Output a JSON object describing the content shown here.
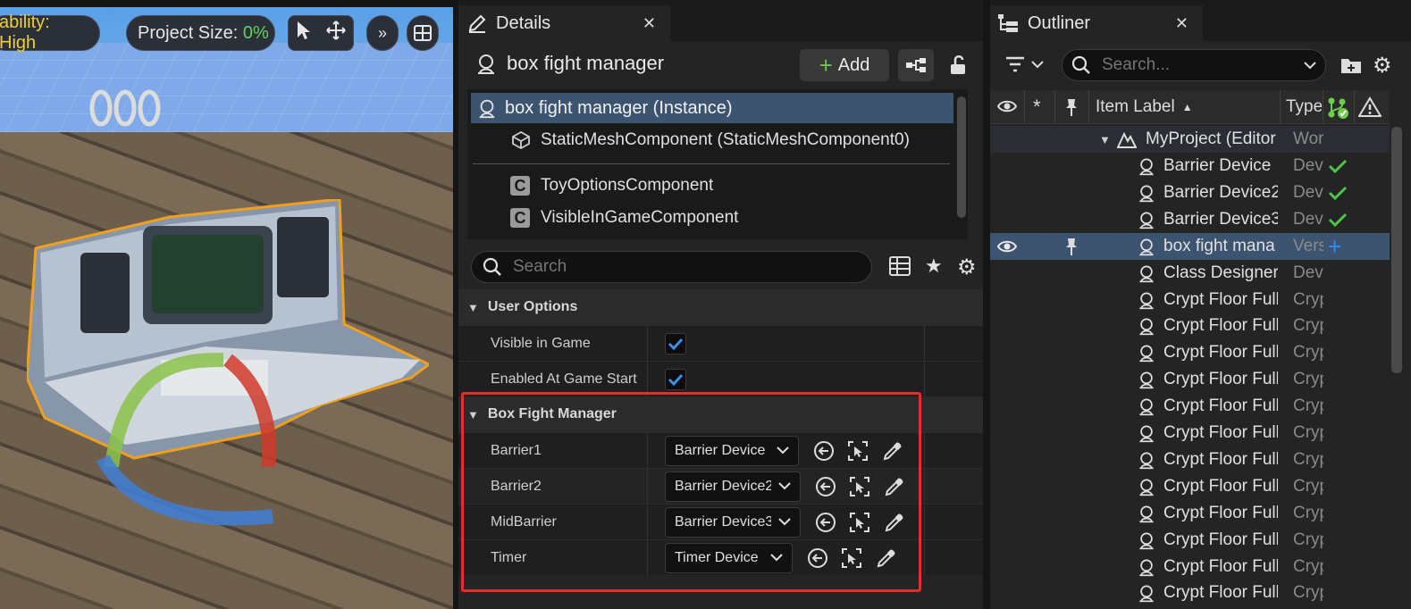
{
  "viewport": {
    "scalability": "ability: High",
    "project_size_label": "Project Size: ",
    "project_size_value": "0%",
    "project_size_color": "#5fd35f"
  },
  "details": {
    "tab_title": "Details",
    "actor_name": "box fight manager",
    "add_label": "Add",
    "components": [
      {
        "label": "box fight manager (Instance)",
        "icon": "actor-icon"
      },
      {
        "label": "StaticMeshComponent (StaticMeshComponent0)",
        "icon": "static-mesh-icon"
      },
      {
        "label": "ToyOptionsComponent",
        "icon": "component-c-icon"
      },
      {
        "label": "VisibleInGameComponent",
        "icon": "component-c-icon"
      }
    ],
    "search_placeholder": "Search",
    "user_options": {
      "header": "User Options",
      "visible_in_game": "Visible in Game",
      "enabled_at_game_start": "Enabled At Game Start"
    },
    "box_fight_manager": {
      "header": "Box Fight Manager",
      "props": [
        {
          "name": "Barrier1",
          "value": "Barrier Device"
        },
        {
          "name": "Barrier2",
          "value": "Barrier Device2"
        },
        {
          "name": "MidBarrier",
          "value": "Barrier Device3"
        },
        {
          "name": "Timer",
          "value": "Timer Device"
        }
      ]
    },
    "highlight_color": "#e0302a"
  },
  "outliner": {
    "tab_title": "Outliner",
    "search_placeholder": "Search...",
    "col_item_label": "Item Label",
    "col_type": "Type",
    "root": {
      "label": "MyProject (Editor",
      "type": "Wor"
    },
    "items": [
      {
        "label": "Barrier Device",
        "type": "Dev",
        "status": "check"
      },
      {
        "label": "Barrier Device2",
        "type": "Dev",
        "status": "check"
      },
      {
        "label": "Barrier Device3",
        "type": "Dev",
        "status": "check"
      },
      {
        "label": "box fight mana",
        "type": "Vers",
        "status": "plus",
        "selected": true
      },
      {
        "label": "Class Designer",
        "type": "Dev",
        "status": ""
      },
      {
        "label": "Crypt Floor Full",
        "type": "Cryp",
        "status": ""
      },
      {
        "label": "Crypt Floor Full",
        "type": "Cryp",
        "status": ""
      },
      {
        "label": "Crypt Floor Full",
        "type": "Cryp",
        "status": ""
      },
      {
        "label": "Crypt Floor Full",
        "type": "Cryp",
        "status": ""
      },
      {
        "label": "Crypt Floor Full",
        "type": "Cryp",
        "status": ""
      },
      {
        "label": "Crypt Floor Full",
        "type": "Cryp",
        "status": ""
      },
      {
        "label": "Crypt Floor Full",
        "type": "Cryp",
        "status": ""
      },
      {
        "label": "Crypt Floor Full",
        "type": "Cryp",
        "status": ""
      },
      {
        "label": "Crypt Floor Full",
        "type": "Cryp",
        "status": ""
      },
      {
        "label": "Crypt Floor Full",
        "type": "Cryp",
        "status": ""
      },
      {
        "label": "Crypt Floor Full",
        "type": "Cryp",
        "status": ""
      },
      {
        "label": "Crypt Floor Full",
        "type": "Cryp",
        "status": ""
      }
    ]
  }
}
